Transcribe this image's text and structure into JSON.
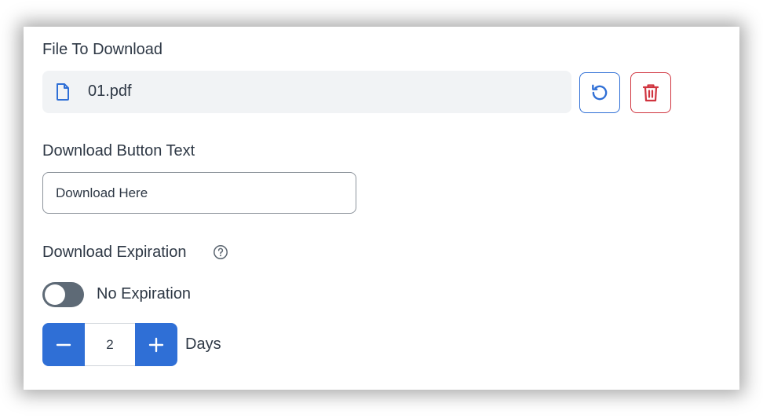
{
  "file_section": {
    "label": "File To Download",
    "file_name": "01.pdf",
    "icons": {
      "file": "file-icon",
      "replace": "refresh-icon",
      "delete": "trash-icon"
    }
  },
  "button_text_section": {
    "label": "Download Button Text",
    "value": "Download Here"
  },
  "expiration_section": {
    "label": "Download Expiration",
    "help_icon": "help-circle-icon",
    "toggle_label": "No Expiration",
    "toggle_on": false,
    "days_value": "2",
    "days_label": "Days"
  },
  "colors": {
    "primary": "#2f6fd6",
    "danger": "#d0343f",
    "toggle_off": "#5e6a76",
    "field_bg": "#f1f3f5"
  }
}
